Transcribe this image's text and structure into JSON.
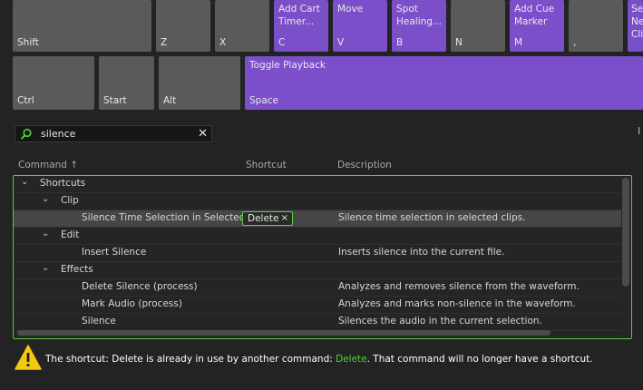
{
  "keyboard": {
    "keys": [
      {
        "label": "Shift",
        "command": ""
      },
      {
        "label": "Z",
        "command": ""
      },
      {
        "label": "X",
        "command": ""
      },
      {
        "label": "C",
        "command": "Add Cart\nTimer..."
      },
      {
        "label": "V",
        "command": "Move"
      },
      {
        "label": "B",
        "command": "Spot\nHealing..."
      },
      {
        "label": "N",
        "command": ""
      },
      {
        "label": "M",
        "command": "Add Cue\nMarker"
      },
      {
        "label": ",",
        "command": ""
      },
      {
        "label": ".",
        "command": "Se\nNe\nCli"
      },
      {
        "label": "Ctrl",
        "command": ""
      },
      {
        "label": "Start",
        "command": ""
      },
      {
        "label": "Alt",
        "command": ""
      },
      {
        "label": "Space",
        "command": "Toggle Playback"
      }
    ]
  },
  "search": {
    "value": "silence",
    "clear_glyph": "✕"
  },
  "side_mark": "I",
  "columns": {
    "command": "Command",
    "sort_glyph": "↑",
    "shortcut": "Shortcut",
    "description": "Description"
  },
  "tree": {
    "shortcuts": "Shortcuts",
    "clip": "Clip",
    "edit": "Edit",
    "effects": "Effects",
    "rows": [
      {
        "command": "Silence Time Selection in Selected C",
        "shortcut": "Delete",
        "description": "Silence time selection in selected clips."
      },
      {
        "command": "Insert Silence",
        "shortcut": "",
        "description": "Inserts silence into the current file."
      },
      {
        "command": "Delete Silence (process)",
        "shortcut": "",
        "description": "Analyzes and removes silence from the waveform."
      },
      {
        "command": "Mark Audio (process)",
        "shortcut": "",
        "description": "Analyzes and marks non-silence in the waveform."
      },
      {
        "command": "Silence",
        "shortcut": "",
        "description": "Silences the audio in the current selection."
      }
    ]
  },
  "chip": {
    "text": "Delete",
    "close_glyph": "×"
  },
  "warning": {
    "prefix": "The shortcut: Delete is already in use by another command: ",
    "highlight": "Delete",
    "suffix": ". That command will no longer have a shortcut."
  },
  "colors": {
    "accent_purple": "#7b4fc9",
    "highlight_green": "#4fd437",
    "warning_yellow": "#f2c811"
  }
}
